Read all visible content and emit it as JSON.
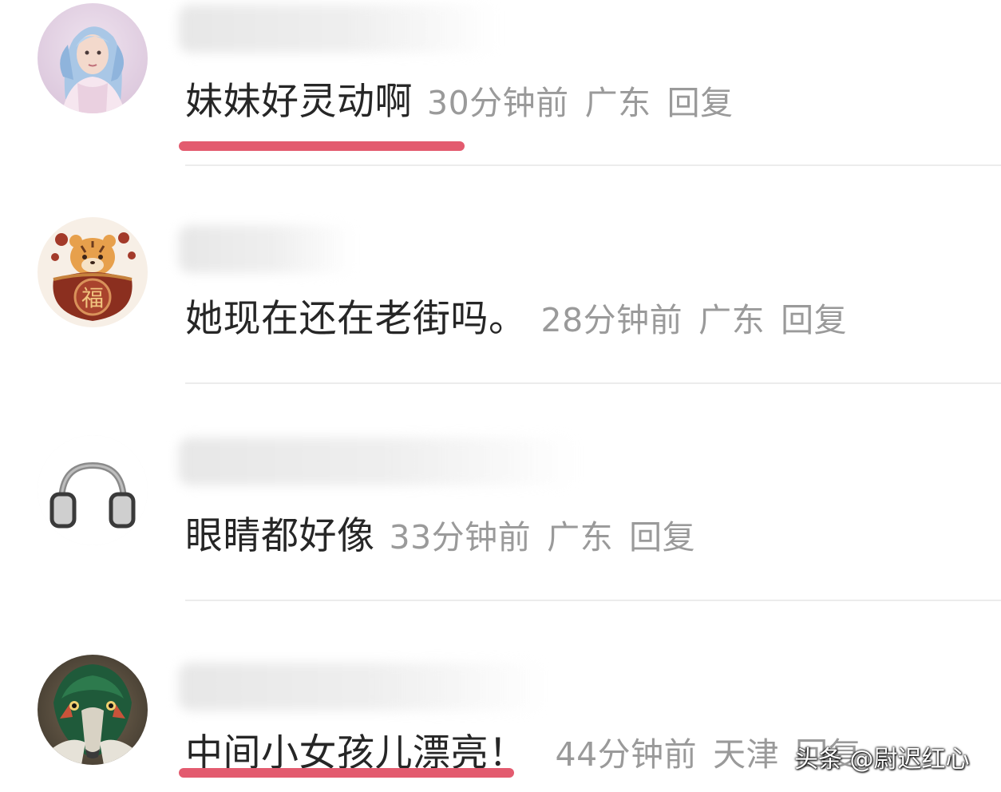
{
  "comments": [
    {
      "text": "妹妹好灵动啊",
      "time": "30分钟前",
      "location": "广东",
      "reply": "回复",
      "avatar": "girl-avatar-icon"
    },
    {
      "text": "她现在还在老街吗。",
      "time": "28分钟前",
      "location": "广东",
      "reply": "回复",
      "avatar": "tiger-fu-avatar-icon"
    },
    {
      "text": "眼睛都好像",
      "time": "33分钟前",
      "location": "广东",
      "reply": "回复",
      "avatar": "headphones-avatar-icon"
    },
    {
      "text": "中间小女孩儿漂亮！",
      "time": "44分钟前",
      "location": "天津",
      "reply": "回复",
      "avatar": "duck-avatar-icon"
    }
  ],
  "avatar_text": {
    "fu": "福"
  },
  "watermark": "头条 @尉迟红心",
  "colors": {
    "highlight_underline": "#e35b6f",
    "meta_gray": "#9a9a9a",
    "text_dark": "#262626"
  }
}
